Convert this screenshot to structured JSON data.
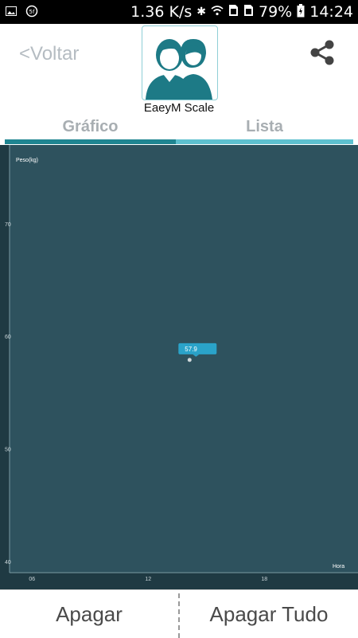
{
  "status_bar": {
    "speed": "1.36 K/s",
    "battery": "79%",
    "time": "14:24",
    "icons": [
      "image-icon",
      "sync-icon",
      "bluetooth-icon",
      "wifi-icon",
      "sim1-icon",
      "sim2-icon",
      "battery-icon"
    ]
  },
  "header": {
    "back_label": "<Voltar",
    "app_title": "EaeyM Scale",
    "share_icon": "share-icon",
    "logo_icon": "couple-logo-icon"
  },
  "tabs": [
    {
      "label": "Gráfico",
      "active": true
    },
    {
      "label": "Lista",
      "active": false
    }
  ],
  "colors": {
    "chart_background": "#2e525e",
    "tab_active": "#1f8591",
    "tab_inactive": "#5ec0cf",
    "tooltip": "#2aa3c9",
    "logo_teal": "#1d7a86"
  },
  "chart_data": {
    "type": "scatter",
    "ylabel": "Peso(kg)",
    "xlabel": "Hora",
    "ylim": [
      39,
      77
    ],
    "xlim": [
      5,
      23
    ],
    "y_ticks": [
      "40",
      "50",
      "60",
      "70"
    ],
    "x_ticks": [
      "06",
      "12",
      "18"
    ],
    "grid": false,
    "points": [
      {
        "x": 14.3,
        "y": 57.9,
        "label": "57.9"
      }
    ]
  },
  "bottom": {
    "apagar": "Apagar",
    "apagar_tudo": "Apagar Tudo"
  }
}
